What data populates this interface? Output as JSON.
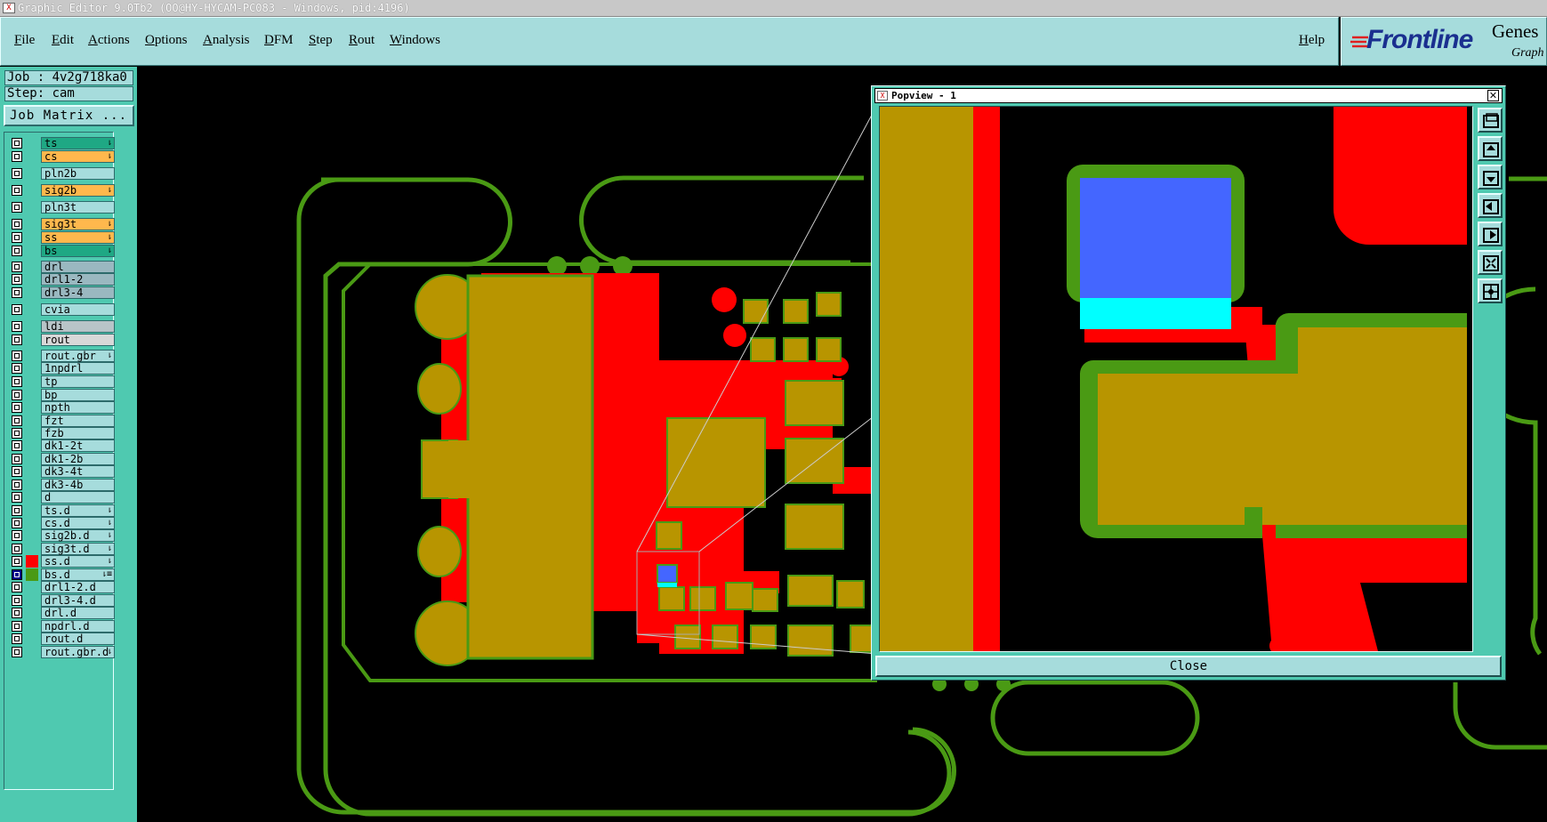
{
  "window": {
    "title": "Graphic Editor 9.0Tb2 (OO@HY-HYCAM-PC083 - Windows, pid:4196)"
  },
  "menu": {
    "items": [
      "File",
      "Edit",
      "Actions",
      "Options",
      "Analysis",
      "DFM",
      "Step",
      "Rout",
      "Windows"
    ],
    "help": "Help"
  },
  "logo": {
    "brand": "Frontline",
    "product": "Genes",
    "sub": "Graph"
  },
  "job": {
    "job_label": "Job : 4v2g718ka0",
    "step_label": "Step: cam",
    "matrix_button": "Job Matrix ..."
  },
  "layers": [
    {
      "name": "ts",
      "color": "#1fa884",
      "mark": "⇂"
    },
    {
      "name": "cs",
      "color": "#ffb84d",
      "mark": "⇂"
    },
    {
      "name": "pln2b",
      "color": "#a6dcdc",
      "mark": ""
    },
    {
      "name": "sig2b",
      "color": "#ffb84d",
      "mark": "⇂"
    },
    {
      "name": "pln3t",
      "color": "#a6dcdc",
      "mark": ""
    },
    {
      "name": "sig3t",
      "color": "#ffb84d",
      "mark": "⇂"
    },
    {
      "name": "ss",
      "color": "#ffb84d",
      "mark": "⇂"
    },
    {
      "name": "bs",
      "color": "#1fa884",
      "mark": "⇂"
    },
    {
      "name": "drl",
      "color": "#9ab8c0",
      "mark": ""
    },
    {
      "name": "drl1-2",
      "color": "#9ab8c0",
      "mark": ""
    },
    {
      "name": "drl3-4",
      "color": "#9ab8c0",
      "mark": ""
    },
    {
      "name": "cvia",
      "color": "#a6dcdc",
      "mark": ""
    },
    {
      "name": "ldi",
      "color": "#b8c4c8",
      "mark": ""
    },
    {
      "name": "rout",
      "color": "#d8d8d8",
      "mark": ""
    },
    {
      "name": "rout.gbr",
      "color": "#a6dcdc",
      "mark": "⇂"
    },
    {
      "name": "1npdrl",
      "color": "#a6dcdc",
      "mark": ""
    },
    {
      "name": "tp",
      "color": "#a6dcdc",
      "mark": ""
    },
    {
      "name": "bp",
      "color": "#a6dcdc",
      "mark": ""
    },
    {
      "name": "npth",
      "color": "#a6dcdc",
      "mark": ""
    },
    {
      "name": "fzt",
      "color": "#a6dcdc",
      "mark": ""
    },
    {
      "name": "fzb",
      "color": "#a6dcdc",
      "mark": ""
    },
    {
      "name": "dk1-2t",
      "color": "#a6dcdc",
      "mark": ""
    },
    {
      "name": "dk1-2b",
      "color": "#a6dcdc",
      "mark": ""
    },
    {
      "name": "dk3-4t",
      "color": "#a6dcdc",
      "mark": ""
    },
    {
      "name": "dk3-4b",
      "color": "#a6dcdc",
      "mark": ""
    },
    {
      "name": "d",
      "color": "#a6dcdc",
      "mark": ""
    },
    {
      "name": "ts.d",
      "color": "#a6dcdc",
      "mark": "⇂"
    },
    {
      "name": "cs.d",
      "color": "#a6dcdc",
      "mark": "⇂"
    },
    {
      "name": "sig2b.d",
      "color": "#a6dcdc",
      "mark": "⇂"
    },
    {
      "name": "sig3t.d",
      "color": "#a6dcdc",
      "mark": "⇂"
    },
    {
      "name": "ss.d",
      "color": "#a6dcdc",
      "mark": "⇂"
    },
    {
      "name": "bs.d",
      "color": "#a6dcdc",
      "mark": "⇂≡"
    },
    {
      "name": "drl1-2.d",
      "color": "#a6dcdc",
      "mark": ""
    },
    {
      "name": "drl3-4.d",
      "color": "#a6dcdc",
      "mark": ""
    },
    {
      "name": "drl.d",
      "color": "#a6dcdc",
      "mark": ""
    },
    {
      "name": "npdrl.d",
      "color": "#a6dcdc",
      "mark": ""
    },
    {
      "name": "rout.d",
      "color": "#a6dcdc",
      "mark": ""
    },
    {
      "name": "rout.gbr.d",
      "color": "#a6dcdc",
      "mark": "⇂"
    }
  ],
  "colors": {
    "board_outline": "#4a9a14",
    "copper": "#b89500",
    "red_layer": "#ff0000",
    "blue_pad": "#4466ff",
    "cyan": "#00ffff",
    "panel_bg": "#4fc9b0",
    "control_bg": "#a6dcdc"
  },
  "popview": {
    "title": "Popview - 1",
    "close_label": "Close",
    "tools": [
      "fit-screen-icon",
      "zoom-up-icon",
      "zoom-down-icon",
      "pan-left-icon",
      "pan-right-icon",
      "zoom-in-icon",
      "zoom-out-icon"
    ]
  }
}
